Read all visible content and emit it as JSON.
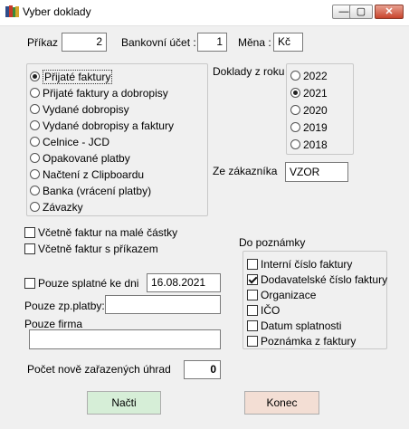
{
  "window": {
    "title": "Vyber doklady",
    "minimize_glyph": "—",
    "maximize_glyph": "▢",
    "close_glyph": "✕"
  },
  "header": {
    "prikaz_label": "Příkaz :",
    "prikaz_value": "2",
    "bankovni_ucet_label": "Bankovní účet :",
    "bankovni_ucet_value": "1",
    "mena_label": "Měna :",
    "mena_value": "Kč"
  },
  "doc_types": {
    "options": [
      "Přijaté faktury",
      "Přijaté faktury a dobropisy",
      "Vydané dobropisy",
      "Vydané dobropisy a faktury",
      "Celnice - JCD",
      "Opakované platby",
      "Načtení z Clipboardu",
      "Banka (vrácení platby)",
      "Závazky"
    ],
    "selected_index": 0
  },
  "years": {
    "label": "Doklady z roku",
    "options": [
      "2022",
      "2021",
      "2020",
      "2019",
      "2018"
    ],
    "selected_index": 1
  },
  "customer": {
    "label": "Ze zákazníka",
    "value": "VZOR"
  },
  "checks": {
    "small_amounts": {
      "label": "Včetně faktur na malé částky",
      "checked": false
    },
    "with_order": {
      "label": "Včetně faktur s příkazem",
      "checked": false
    },
    "only_due": {
      "label": "Pouze splatné ke dni",
      "checked": false,
      "date": "16.08.2021"
    }
  },
  "filters": {
    "payment_method_label": "Pouze zp.platby:",
    "payment_method_value": "",
    "company_label": "Pouze firma",
    "company_value": ""
  },
  "notes": {
    "label": "Do poznámky",
    "items": [
      {
        "label": "Interní číslo faktury",
        "checked": false
      },
      {
        "label": "Dodavatelské číslo faktury",
        "checked": true
      },
      {
        "label": "Organizace",
        "checked": false
      },
      {
        "label": "IČO",
        "checked": false
      },
      {
        "label": "Datum splatnosti",
        "checked": false
      },
      {
        "label": "Poznámka z faktury",
        "checked": false
      }
    ]
  },
  "count": {
    "label": "Počet nově zařazených úhrad",
    "value": "0"
  },
  "buttons": {
    "load": "Načti",
    "close": "Konec"
  },
  "colors": {
    "load_button": "#d6eed7",
    "close_button": "#f3ded4",
    "window_bg": "#f0f0f0"
  }
}
